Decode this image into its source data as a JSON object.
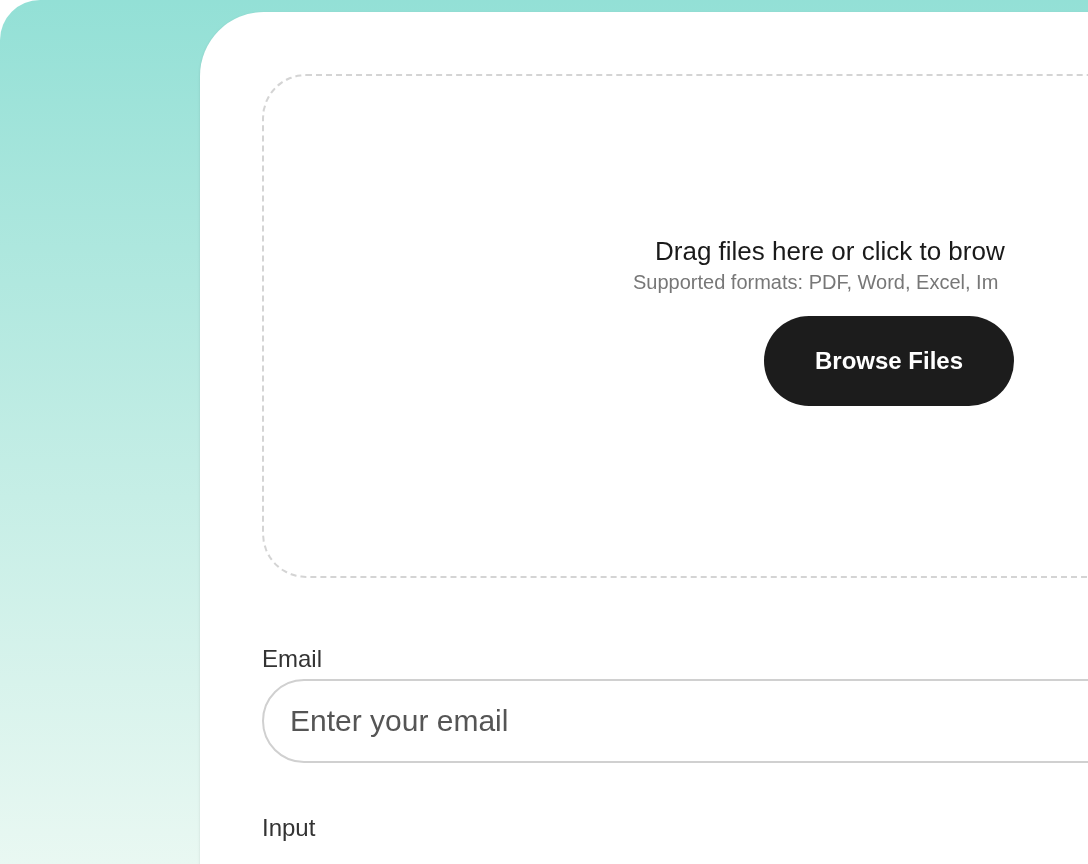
{
  "dropzone": {
    "title": "Drag files here or click to brow",
    "formats": "Supported formats: PDF, Word, Excel, Im",
    "button": "Browse Files"
  },
  "fields": [
    {
      "label": "Email",
      "placeholder": "Enter your email"
    }
  ],
  "next_label": "Input"
}
